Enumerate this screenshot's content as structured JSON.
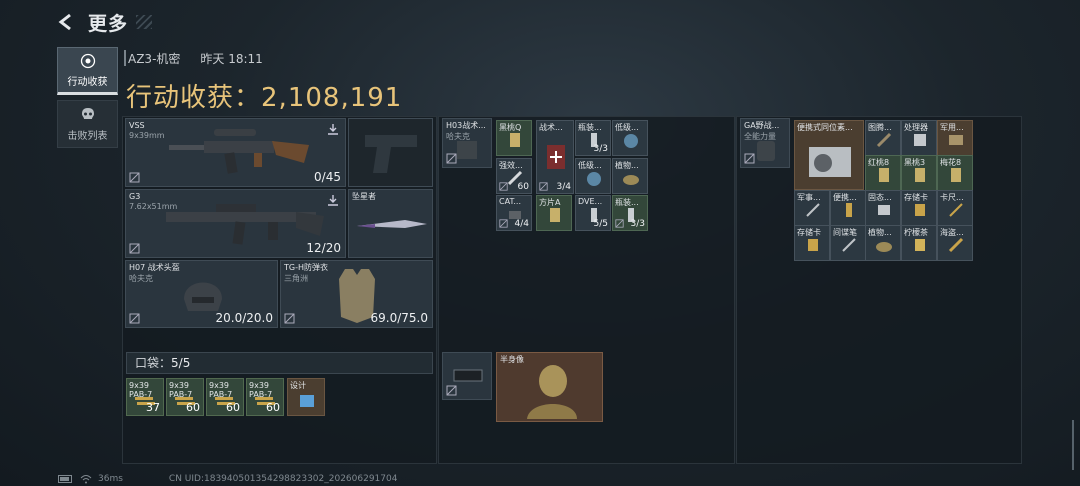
{
  "header": {
    "title": "更多"
  },
  "tabs": [
    {
      "label": "行动收获",
      "icon": "target-icon",
      "active": true
    },
    {
      "label": "击败列表",
      "icon": "skull-icon",
      "active": false
    }
  ],
  "meta": {
    "map": "AZ3-机密",
    "time": "昨天 18:11"
  },
  "haul": {
    "label": "行动收获：",
    "value": "2,108,191"
  },
  "equipment": {
    "primary1": {
      "name": "VSS",
      "sub": "9x39mm",
      "count": "0/45"
    },
    "primary2": {
      "name": "G3",
      "sub": "7.62x51mm",
      "count": "12/20"
    },
    "melee": {
      "name": "坠星者"
    },
    "helmet": {
      "name": "H07 战术头盔",
      "sub": "哈夫克",
      "count": "20.0/20.0"
    },
    "armor": {
      "name": "TG-H防弹衣",
      "sub": "三角洲",
      "count": "69.0/75.0"
    }
  },
  "pocket": {
    "label": "口袋：",
    "value": "5/5"
  },
  "pocket_items": [
    {
      "name": "9x39",
      "name2": "PAB-7",
      "count": "37"
    },
    {
      "name": "9x39",
      "name2": "PAB-7",
      "count": "60"
    },
    {
      "name": "9x39",
      "name2": "PAB-7",
      "count": "60"
    },
    {
      "name": "9x39",
      "name2": "PAB-7",
      "count": "60"
    },
    {
      "name": "设计",
      "name2": "",
      "count": ""
    }
  ],
  "rig": {
    "name": "H03战术...",
    "sub": "哈夫克",
    "items": [
      {
        "name": "黑桃Q",
        "count": ""
      },
      {
        "name": "战术...",
        "count": ""
      },
      {
        "name": "瓶装...",
        "count": "3/3"
      },
      {
        "name": "低级...",
        "count": ""
      },
      {
        "name": "强效...",
        "count": "60"
      },
      {
        "name": "",
        "count": "3/4"
      },
      {
        "name": "低级...",
        "count": ""
      },
      {
        "name": "植物...",
        "count": ""
      },
      {
        "name": "CAT...",
        "count": "4/4"
      },
      {
        "name": "方片A",
        "count": ""
      },
      {
        "name": "DVE...",
        "count": "5/5"
      },
      {
        "name": "瓶装...",
        "count": "3/3"
      }
    ]
  },
  "safebox": {
    "name": "",
    "item": "半身像"
  },
  "backpack": {
    "name": "GA野战...",
    "sub": "全能力量",
    "big_item": "便携式同位素...",
    "items": [
      "图腾...",
      "处理器",
      "军用...",
      "红桃8",
      "黑桃3",
      "梅花8",
      "军事...",
      "便携...",
      "固态...",
      "存储卡",
      "卡尺...",
      "存储卡",
      "间谍笔",
      "植物...",
      "柠檬茶",
      "海盗..."
    ]
  },
  "footer": {
    "ping": "36ms",
    "uid": "CN UID:183940501354298823302_202606291704"
  }
}
